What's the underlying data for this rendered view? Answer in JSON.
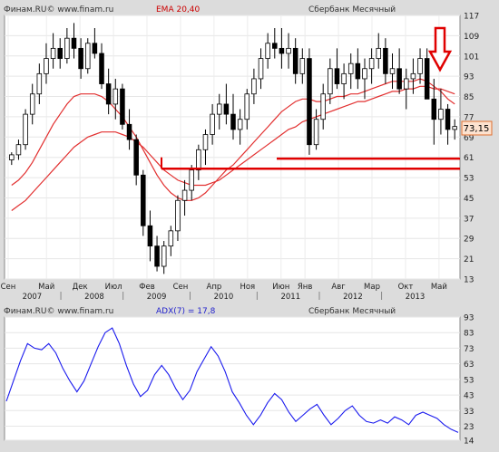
{
  "chart_data": [
    {
      "type": "candlestick",
      "header_left": "Финам.RU© www.finam.ru",
      "indicator_label": "EMA 20,40",
      "title": "Сбербанк Месячный",
      "ylim": [
        13,
        117
      ],
      "yticks": [
        13,
        21,
        29,
        37,
        45,
        53,
        61,
        69,
        77,
        85,
        93,
        101,
        109,
        117
      ],
      "last_price_label": "73,15",
      "month_labels": [
        "Сен",
        "Май",
        "Дек",
        "Июл",
        "Фев",
        "Сен",
        "Апр",
        "Ноя",
        "Июн",
        "Янв",
        "Авг",
        "Мар",
        "Окт",
        "Май"
      ],
      "year_labels": [
        "2007",
        "2008",
        "2009",
        "2010",
        "2011",
        "2012",
        "2013"
      ],
      "horizontal_lines": [
        {
          "y": 60.5,
          "x_from": "2011-06"
        },
        {
          "y": 56.5,
          "x_from": "2009-09"
        }
      ],
      "annotation": "down-arrow",
      "candles": [
        [
          60,
          63,
          58,
          62
        ],
        [
          62,
          68,
          60,
          66
        ],
        [
          66,
          80,
          64,
          78
        ],
        [
          78,
          90,
          74,
          86
        ],
        [
          86,
          98,
          82,
          94
        ],
        [
          94,
          106,
          90,
          100
        ],
        [
          100,
          110,
          96,
          104
        ],
        [
          104,
          108,
          96,
          100
        ],
        [
          100,
          112,
          98,
          108
        ],
        [
          108,
          114,
          100,
          104
        ],
        [
          104,
          108,
          92,
          96
        ],
        [
          96,
          108,
          94,
          106
        ],
        [
          106,
          112,
          100,
          102
        ],
        [
          102,
          106,
          88,
          90
        ],
        [
          90,
          96,
          78,
          82
        ],
        [
          82,
          92,
          76,
          88
        ],
        [
          88,
          90,
          72,
          74
        ],
        [
          74,
          80,
          64,
          68
        ],
        [
          68,
          70,
          50,
          54
        ],
        [
          54,
          56,
          30,
          34
        ],
        [
          34,
          40,
          20,
          26
        ],
        [
          26,
          30,
          16,
          18
        ],
        [
          18,
          28,
          15,
          26
        ],
        [
          26,
          34,
          22,
          32
        ],
        [
          32,
          46,
          28,
          44
        ],
        [
          44,
          52,
          38,
          48
        ],
        [
          48,
          58,
          44,
          56
        ],
        [
          56,
          66,
          52,
          64
        ],
        [
          64,
          72,
          58,
          70
        ],
        [
          70,
          82,
          66,
          78
        ],
        [
          78,
          86,
          72,
          82
        ],
        [
          82,
          90,
          74,
          78
        ],
        [
          78,
          86,
          68,
          72
        ],
        [
          72,
          80,
          66,
          76
        ],
        [
          76,
          88,
          72,
          86
        ],
        [
          86,
          96,
          82,
          92
        ],
        [
          92,
          104,
          88,
          100
        ],
        [
          100,
          110,
          96,
          106
        ],
        [
          106,
          112,
          100,
          104
        ],
        [
          104,
          112,
          96,
          102
        ],
        [
          102,
          110,
          96,
          104
        ],
        [
          104,
          108,
          90,
          94
        ],
        [
          94,
          104,
          90,
          100
        ],
        [
          100,
          104,
          62,
          66
        ],
        [
          66,
          80,
          64,
          76
        ],
        [
          76,
          90,
          72,
          86
        ],
        [
          86,
          100,
          82,
          96
        ],
        [
          96,
          104,
          88,
          90
        ],
        [
          90,
          98,
          84,
          94
        ],
        [
          94,
          102,
          88,
          98
        ],
        [
          98,
          104,
          88,
          92
        ],
        [
          92,
          100,
          84,
          96
        ],
        [
          96,
          104,
          90,
          100
        ],
        [
          100,
          110,
          96,
          104
        ],
        [
          104,
          108,
          90,
          94
        ],
        [
          94,
          102,
          88,
          96
        ],
        [
          96,
          104,
          86,
          88
        ],
        [
          88,
          96,
          80,
          92
        ],
        [
          92,
          100,
          86,
          94
        ],
        [
          94,
          104,
          90,
          100
        ],
        [
          100,
          104,
          88,
          84
        ],
        [
          84,
          92,
          66,
          76
        ],
        [
          76,
          88,
          70,
          80
        ],
        [
          80,
          82,
          66,
          72
        ],
        [
          72,
          76,
          68,
          73.15
        ]
      ],
      "ema20": [
        50,
        52,
        55,
        59,
        64,
        69,
        74,
        78,
        82,
        85,
        86,
        86,
        86,
        85,
        83,
        80,
        77,
        73,
        69,
        64,
        59,
        54,
        50,
        47,
        45,
        44,
        44,
        45,
        47,
        50,
        53,
        56,
        58,
        61,
        64,
        67,
        70,
        73,
        76,
        79,
        81,
        83,
        84,
        84,
        83,
        83,
        84,
        85,
        85,
        86,
        86,
        87,
        88,
        89,
        90,
        91,
        91,
        91,
        91,
        92,
        91,
        89,
        87,
        84,
        82
      ],
      "ema40": [
        40,
        42,
        44,
        47,
        50,
        53,
        56,
        59,
        62,
        65,
        67,
        69,
        70,
        71,
        71,
        71,
        70,
        69,
        67,
        65,
        62,
        59,
        56,
        54,
        52,
        51,
        50,
        50,
        50,
        51,
        52,
        54,
        56,
        58,
        60,
        62,
        64,
        66,
        68,
        70,
        72,
        73,
        75,
        76,
        77,
        78,
        79,
        80,
        81,
        82,
        83,
        83,
        84,
        85,
        86,
        87,
        87,
        88,
        88,
        89,
        89,
        88,
        88,
        87,
        86
      ]
    },
    {
      "type": "line",
      "header_left": "Финам.RU© www.finam.ru",
      "indicator_label": "ADX(7) = 17,8",
      "title": "Сбербанк Месячный",
      "ylim": [
        14,
        93
      ],
      "yticks": [
        14,
        23,
        33,
        43,
        53,
        63,
        73,
        83,
        93
      ],
      "values": [
        39,
        52,
        65,
        76,
        73,
        72,
        76,
        70,
        60,
        52,
        45,
        52,
        63,
        74,
        83,
        86,
        76,
        62,
        50,
        42,
        46,
        56,
        62,
        56,
        47,
        40,
        46,
        58,
        66,
        74,
        68,
        58,
        45,
        38,
        30,
        24,
        30,
        38,
        44,
        40,
        32,
        26,
        30,
        34,
        37,
        30,
        24,
        28,
        33,
        36,
        30,
        26,
        25,
        27,
        25,
        29,
        27,
        24,
        30,
        32,
        30,
        28,
        24,
        21,
        19
      ]
    }
  ]
}
